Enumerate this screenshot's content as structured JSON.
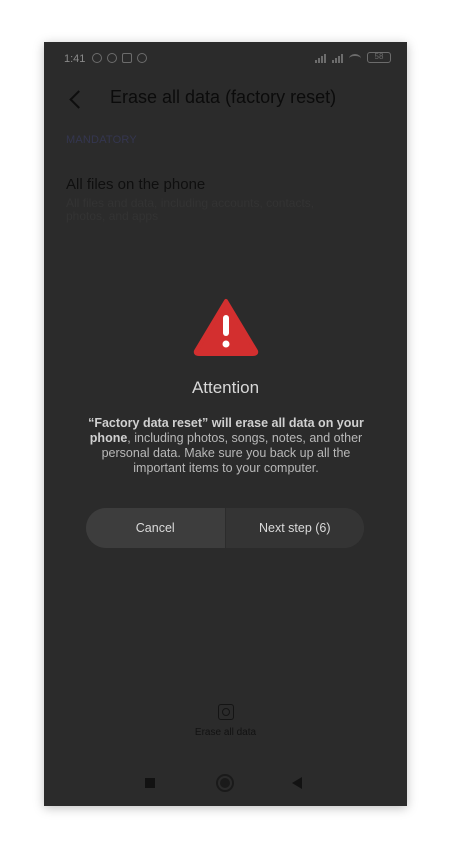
{
  "status_bar": {
    "time": "1:41",
    "left_icons": [
      "gear-icon",
      "circle-icon",
      "trash-icon",
      "alert-icon"
    ],
    "battery": "58"
  },
  "header": {
    "title": "Erase all data (factory reset)"
  },
  "section": {
    "label": "MANDATORY",
    "item_title": "All files on the phone",
    "item_description": "All files and data, including accounts, contacts, photos, and apps"
  },
  "dialog": {
    "title": "Attention",
    "message_bold_1": "“Factory data reset” will erase all data on your phone",
    "message_rest": ", including photos, songs, notes, and other personal data. Make sure you back up all the important items to your computer.",
    "cancel_label": "Cancel",
    "next_label": "Next step (6)"
  },
  "bottom_action": {
    "label": "Erase all data"
  },
  "colors": {
    "overlay": "#2b2b2b",
    "warning_red": "#d32f2f"
  }
}
